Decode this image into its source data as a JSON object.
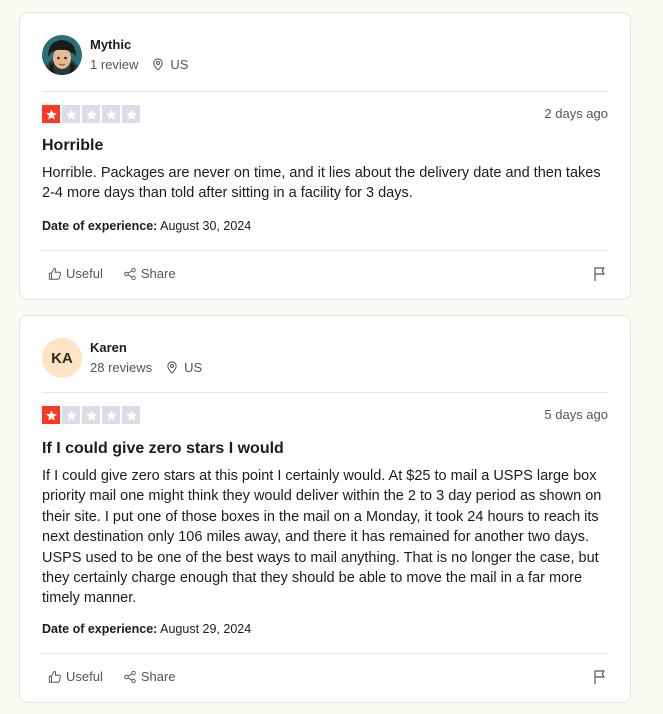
{
  "reviews": [
    {
      "reviewer_name": "Mythic",
      "reviewer_reviews": "1 review",
      "reviewer_country": "US",
      "avatar_initials": "",
      "rating": 1,
      "date": "2 days ago",
      "title": "Horrible",
      "text": "Horrible. Packages are never on time, and it lies about the delivery date and then takes 2-4 more days than told after sitting in a facility for 3 days.",
      "experience_label": "Date of experience:",
      "experience_date": "August 30, 2024",
      "useful_label": "Useful",
      "share_label": "Share"
    },
    {
      "reviewer_name": "Karen",
      "reviewer_reviews": "28 reviews",
      "reviewer_country": "US",
      "avatar_initials": "KA",
      "rating": 1,
      "date": "5 days ago",
      "title": "If I could give zero stars I would",
      "text": "If I could give zero stars at this point I certainly would. At $25 to mail a USPS large box priority mail one might think they would deliver within the 2 to 3 day period as shown on their site. I put one of those boxes in the mail on a Monday, it took 24 hours to reach its next destination only 106 miles away, and there it has remained for another two days. USPS used to be one of the best ways to mail anything. That is no longer the case, but they certainly charge enough that they should be able to move the mail in a far more timely manner.",
      "experience_label": "Date of experience:",
      "experience_date": "August 29, 2024",
      "useful_label": "Useful",
      "share_label": "Share"
    }
  ],
  "colors": {
    "star_filled": "#ff3722",
    "star_empty": "#dcdce6",
    "avatar_initials_bg": "#ffe3c2",
    "page_bg": "#fcfbf3"
  },
  "icons": {
    "location": "location-pin-icon",
    "useful": "thumbs-up-icon",
    "share": "share-icon",
    "flag": "flag-icon",
    "star": "star-icon"
  }
}
